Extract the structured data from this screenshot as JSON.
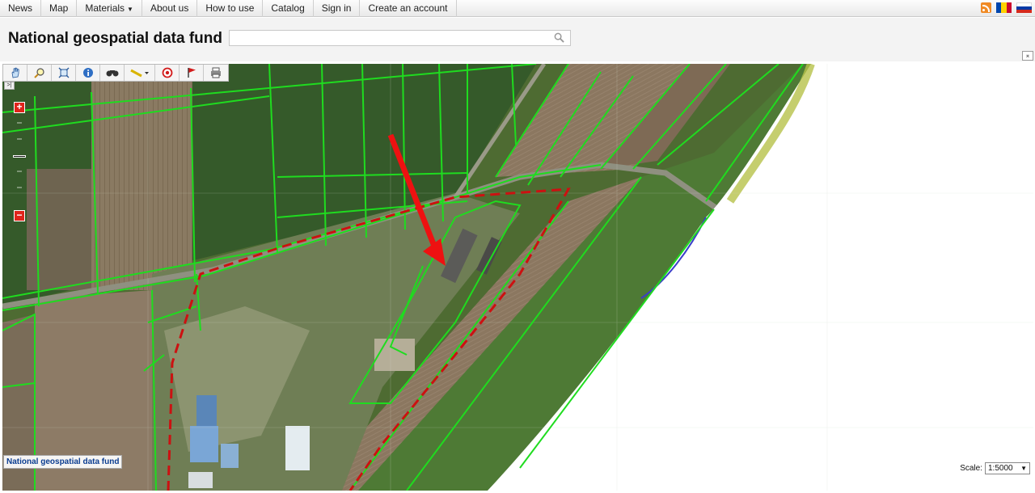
{
  "nav": {
    "items": [
      {
        "label": "News"
      },
      {
        "label": "Map"
      },
      {
        "label": "Materials",
        "has_dropdown": true
      },
      {
        "label": "About us"
      },
      {
        "label": "How to use"
      },
      {
        "label": "Catalog"
      },
      {
        "label": "Sign in"
      },
      {
        "label": "Create an account"
      }
    ],
    "icons": [
      "rss-icon",
      "flag-moldova-icon",
      "flag-russia-icon"
    ]
  },
  "header": {
    "title": "National geospatial data fund",
    "search": {
      "value": "",
      "placeholder": ""
    },
    "collapse_icon": "collapse-up-icon"
  },
  "map": {
    "toolbar": [
      "pan-tool-icon",
      "zoom-box-icon",
      "zoom-extent-icon",
      "identify-icon",
      "find-icon",
      "measure-icon",
      "locate-icon",
      "flag-icon",
      "print-icon"
    ],
    "layer_toggle_label": ">|",
    "zoom_in_label": "+",
    "zoom_out_label": "−",
    "attribution_label": "National geospatial data fund",
    "scale": {
      "label": "Scale:",
      "value": "1:5000"
    },
    "colors": {
      "parcel_lines": "#1fdc1f",
      "boundary_dashed": "#cc1111",
      "arrow": "#ee1111",
      "zoom_buttons": "#e0241b"
    }
  }
}
